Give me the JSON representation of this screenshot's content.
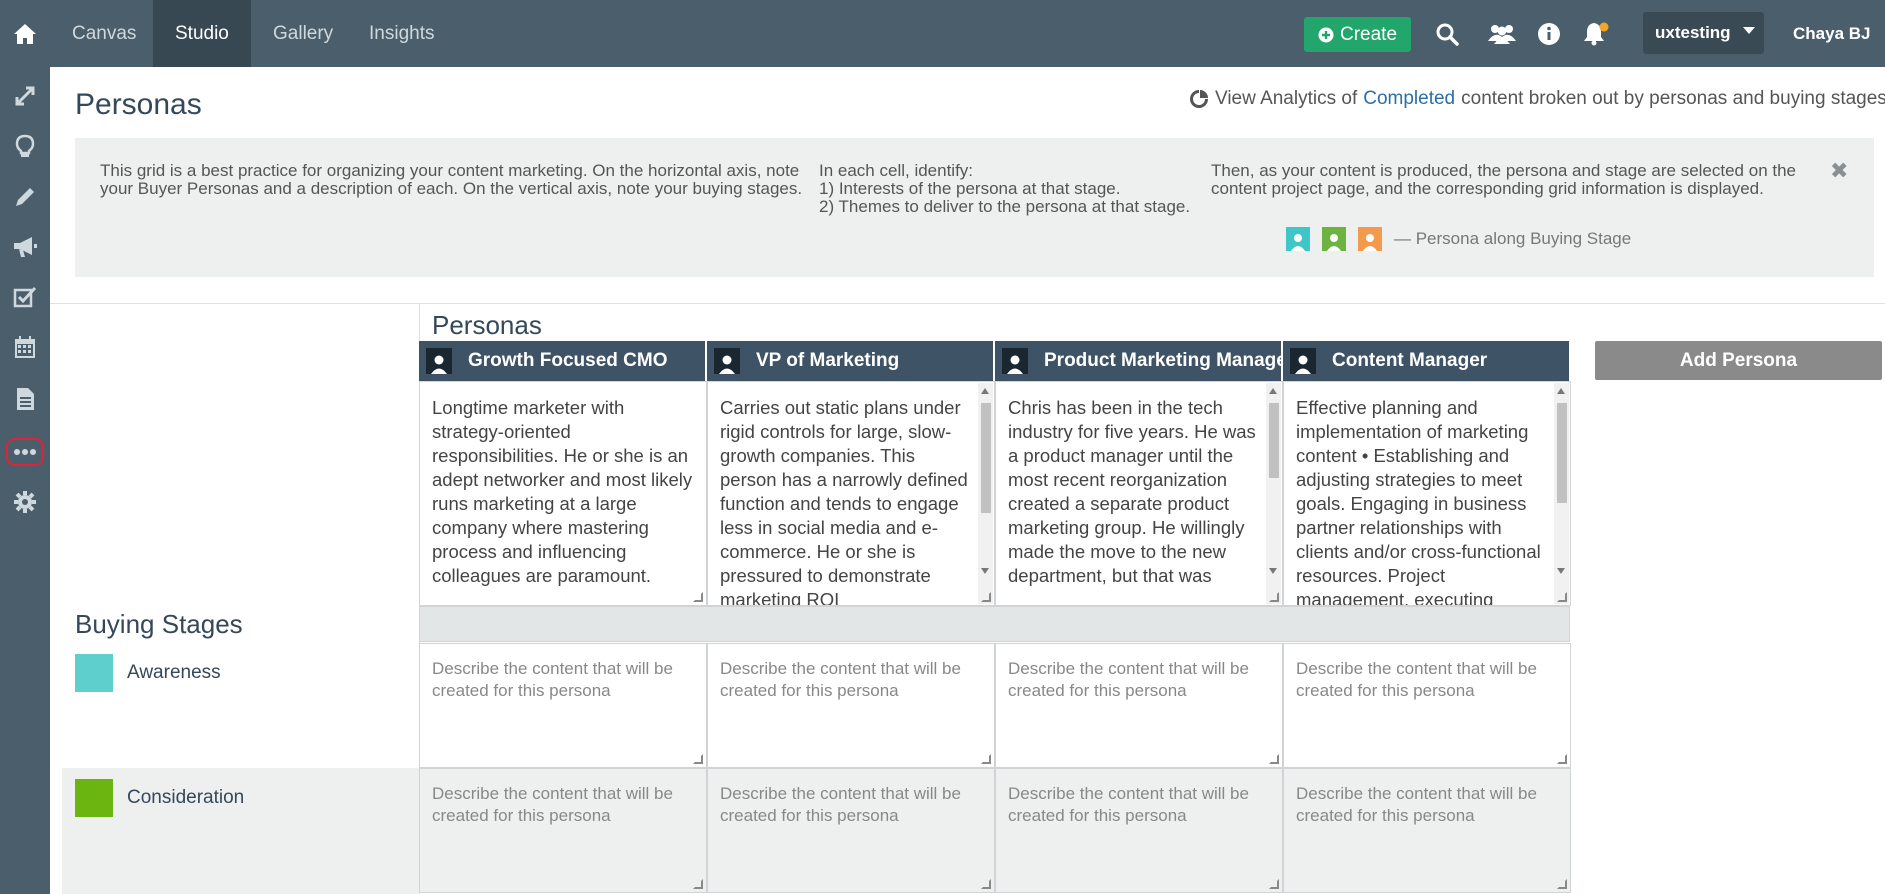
{
  "nav": {
    "tabs": [
      {
        "label": "Canvas"
      },
      {
        "label": "Studio"
      },
      {
        "label": "Gallery"
      },
      {
        "label": "Insights"
      }
    ],
    "create_label": "Create",
    "workspace": "uxtesting",
    "user": "Chaya BJ"
  },
  "page": {
    "title": "Personas",
    "analytics_prefix": "View Analytics of",
    "analytics_link": "Completed",
    "analytics_suffix": "content broken out by personas and buying stages."
  },
  "info": {
    "col1": "This grid is a best practice for organizing your content marketing. On the horizontal axis, note your Buyer Personas and a description of each. On the vertical axis, note your buying stages.",
    "col2_line1": "In each cell, identify:",
    "col2_line2": "1) Interests of the persona at that stage.",
    "col2_line3": "2) Themes to deliver to the persona at that stage.",
    "col3": "Then, as your content is produced, the persona and stage are selected on the content project page, and the corresponding grid information is displayed.",
    "legend_text": "— Persona along Buying Stage",
    "legend_colors": [
      "#3fc6c8",
      "#6cb33f",
      "#f39a4c"
    ]
  },
  "grid": {
    "title": "Personas",
    "add_persona_label": "Add Persona",
    "personas": [
      {
        "name": "Growth Focused CMO",
        "description": "Longtime marketer with strategy-oriented responsibilities. He or she is an adept networker and most likely runs marketing at a large company where mastering process and influencing colleagues are paramount."
      },
      {
        "name": "VP of Marketing",
        "description": "Carries out static plans under rigid controls for large, slow-growth companies. This person has a narrowly defined function and tends to engage less in social media and e-commerce. He or she is pressured to demonstrate marketing ROI"
      },
      {
        "name": "Product Marketing Manager",
        "description": "Chris has been in the tech industry for five years. He was a product manager until the most recent reorganization created a separate product marketing group. He willingly made the move to the new department, but that was"
      },
      {
        "name": "Content Manager",
        "description": "Effective planning and implementation of marketing content  • Establishing and adjusting strategies to meet goals. Engaging in business partner relationships with clients and/or cross-functional resources. Project management, executing"
      }
    ]
  },
  "stages": {
    "title": "Buying Stages",
    "items": [
      {
        "label": "Awareness",
        "color": "#5ecfcd"
      },
      {
        "label": "Consideration",
        "color": "#6cb510"
      }
    ],
    "cell_placeholder": "Describe the content that will be created for this persona"
  }
}
